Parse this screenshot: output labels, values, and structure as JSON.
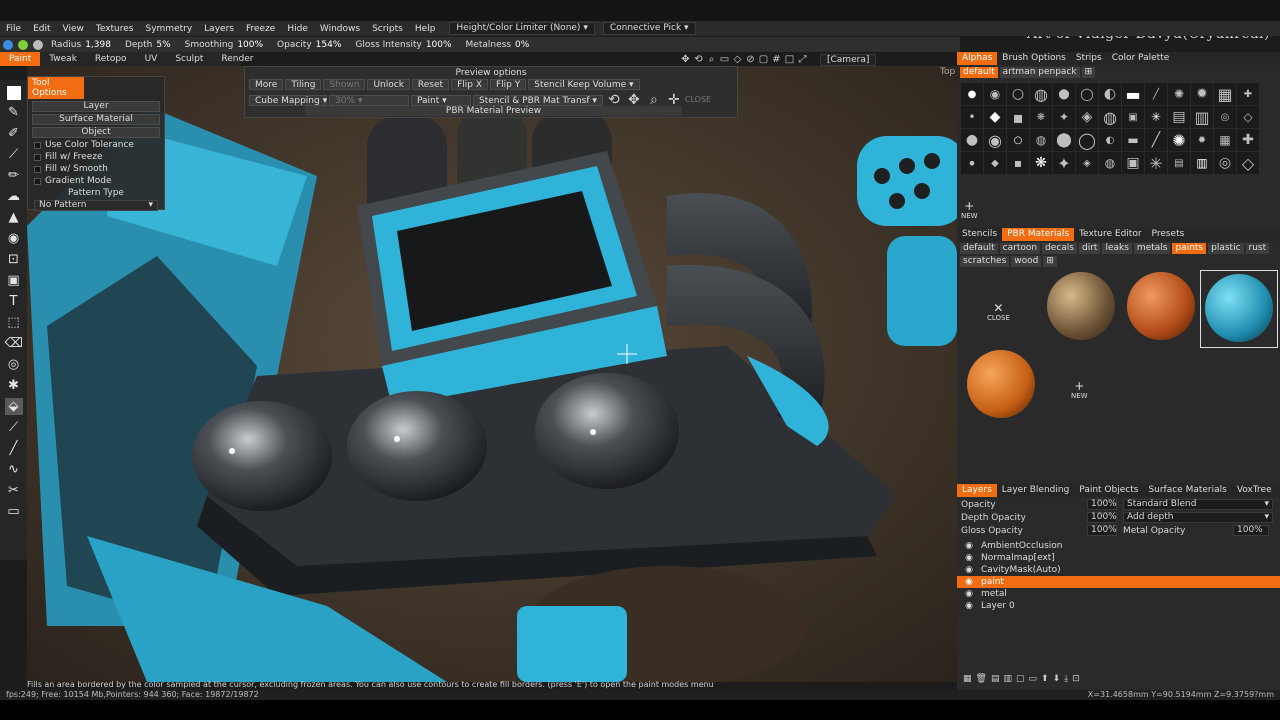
{
  "menu": {
    "items": [
      "File",
      "Edit",
      "View",
      "Textures",
      "Symmetry",
      "Layers",
      "Freeze",
      "Hide",
      "Windows",
      "Scripts",
      "Help"
    ],
    "limiter": "Height/Color Limiter (None)",
    "pick": "Connective Pick"
  },
  "brand": "Art of Vidiger Davyd(Cryunreal)",
  "params": {
    "radius_label": "Radius",
    "radius_val": "1,398",
    "depth_label": "Depth",
    "depth_val": "5%",
    "smoothing_label": "Smoothing",
    "smoothing_val": "100%",
    "opacity_label": "Opacity",
    "opacity_val": "154%",
    "gloss_label": "Gloss Intensity",
    "gloss_val": "100%",
    "metal_label": "Metalness",
    "metal_val": "0%"
  },
  "rooms": [
    "Paint",
    "Tweak",
    "Retopo",
    "UV",
    "Sculpt",
    "Render"
  ],
  "camera": "[Camera]",
  "view_label": "Top",
  "tool_options": {
    "header": "Tool Options",
    "layer": "Layer",
    "surface_material": "Surface Material",
    "object": "Object",
    "use_color_tolerance": "Use Color Tolerance",
    "fill_freeze": "Fill w/ Freeze",
    "fill_smooth": "Fill w/ Smooth",
    "gradient_mode": "Gradient Mode",
    "pattern_type": "Pattern Type",
    "no_pattern": "No Pattern"
  },
  "preview": {
    "title": "Preview options",
    "row1": [
      "More",
      "Tiling",
      "Shown",
      "Unlock",
      "Reset",
      "Flip X",
      "Flip Y"
    ],
    "stencil_keep": "Stencil Keep Volume",
    "cube_mapping": "Cube Mapping",
    "pct": "30%",
    "paint": "Paint",
    "stencil_pbr": "Stencil & PBR Mat Transf",
    "close": "CLOSE",
    "pbr_label": "PBR Material Preview"
  },
  "right": {
    "top_tabs": [
      "Alphas",
      "Brush Options",
      "Strips",
      "Color Palette"
    ],
    "alpha_sets": [
      "default",
      "artman penpack"
    ],
    "new": "NEW",
    "mat_tabs": [
      "Stencils",
      "PBR Materials",
      "Texture Editor",
      "Presets"
    ],
    "mat_chips": [
      "default",
      "cartoon",
      "decals",
      "dirt",
      "leaks",
      "metals",
      "paints",
      "plastic",
      "rust",
      "scratches",
      "wood"
    ],
    "close": "CLOSE",
    "layer_tabs": [
      "Layers",
      "Layer Blending",
      "Paint Objects",
      "Surface Materials",
      "VoxTree"
    ],
    "opacity_label": "Opacity",
    "opacity_val": "100%",
    "blend": "Standard Blend",
    "depth_label": "Depth Opacity",
    "depth_val": "100%",
    "depth_mode": "Add depth",
    "gloss_label": "Gloss Opacity",
    "gloss_val": "100%",
    "metal_label": "Metal Opacity",
    "metal_val": "100%",
    "layers": [
      "AmbientOcclusion",
      "Normalmap[ext]",
      "CavityMask(Auto)",
      "paint",
      "metal",
      "Layer 0"
    ]
  },
  "status": "Fills an area bordered by the color sampled at the cursor, excluding frozen areas. You can also use contours to create fill borders. (press 'E') to open the paint modes menu",
  "info_left": "fps:249;  Free: 10154 Mb,Pointers: 944 360; Face: 19872/19872",
  "info_right": "X=31.4658mm Y=90.5194mm Z=9.3759?mm",
  "colors": {
    "accent": "#f26c12",
    "teal": "#2fb7d8"
  }
}
